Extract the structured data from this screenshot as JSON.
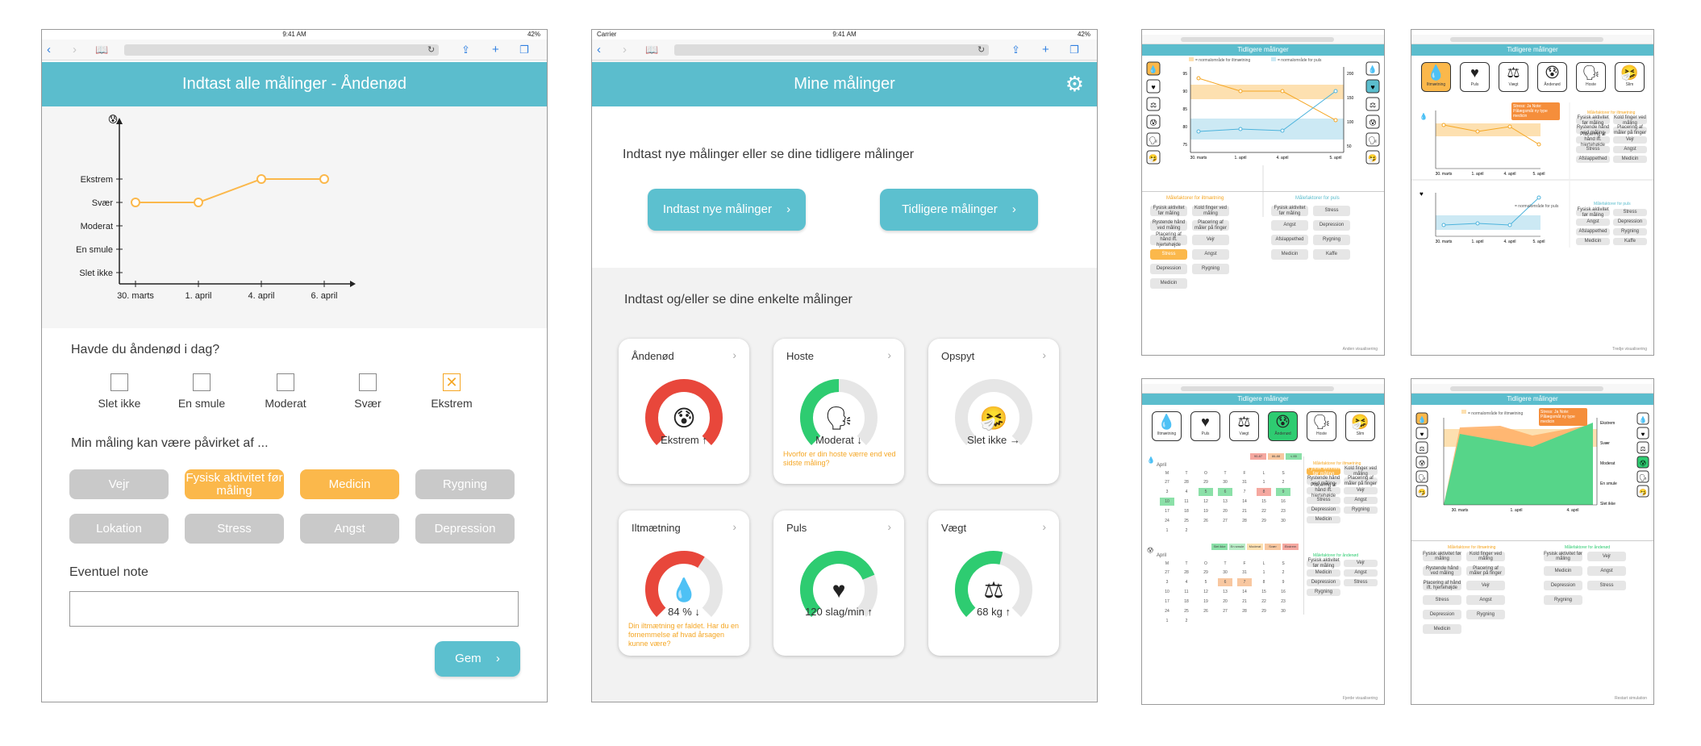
{
  "colors": {
    "teal": "#5bbdcd",
    "orange": "#fbb84b",
    "gray_pill": "#c9c9c9",
    "red_gauge": "#e8473b",
    "green_gauge": "#2ecc71",
    "warn": "#f5a623"
  },
  "s1": {
    "status_time": "9:41 AM",
    "status_battery": "42%",
    "title": "Indtast alle målinger - Åndenød",
    "chart_data": {
      "type": "line",
      "categories": [
        "30. marts",
        "1. april",
        "4. april",
        "6. april"
      ],
      "y_levels": [
        "Slet ikke",
        "En smule",
        "Moderat",
        "Svær",
        "Ekstrem"
      ],
      "values": [
        3,
        3,
        4,
        4
      ],
      "color": "#fbb84b"
    },
    "question": "Havde du åndenød i dag?",
    "options": [
      "Slet ikke",
      "En smule",
      "Moderat",
      "Svær",
      "Ekstrem"
    ],
    "selected_option": "Ekstrem",
    "affected_label": "Min måling kan være påvirket af ...",
    "factors": [
      {
        "label": "Vejr",
        "active": false
      },
      {
        "label": "Fysisk aktivitet før måling",
        "active": true
      },
      {
        "label": "Medicin",
        "active": true
      },
      {
        "label": "Rygning",
        "active": false
      },
      {
        "label": "Lokation",
        "active": false
      },
      {
        "label": "Stress",
        "active": false
      },
      {
        "label": "Angst",
        "active": false
      },
      {
        "label": "Depression",
        "active": false
      }
    ],
    "note_label": "Eventuel note",
    "note_value": "",
    "save_label": "Gem"
  },
  "s2": {
    "status_carrier": "Carrier",
    "status_time": "9:41 AM",
    "status_battery": "42%",
    "title": "Mine målinger",
    "intro": "Indtast nye målinger eller se dine tidligere målinger",
    "btn_new": "Indtast nye målinger",
    "btn_prev": "Tidligere målinger",
    "section": "Indtast og/eller se dine enkelte målinger",
    "cards": [
      {
        "title": "Åndenød",
        "value": "Ekstrem ↑",
        "level": 1.0,
        "color": "#e8473b",
        "icon": "😰",
        "warn": ""
      },
      {
        "title": "Hoste",
        "value": "Moderat ↓",
        "level": 0.5,
        "color": "#2ecc71",
        "icon": "🗣",
        "warn": "Hvorfor er din hoste værre end ved sidste måling?"
      },
      {
        "title": "Opspyt",
        "value": "Slet ikke →",
        "level": 0.0,
        "color": "#2ecc71",
        "icon": "🤧",
        "warn": ""
      },
      {
        "title": "Iltmætning",
        "value": "84 % ↓",
        "level": 0.62,
        "color": "#e8473b",
        "icon": "💧",
        "warn": "Din iltmætning er faldet. Har du en fornemmelse af hvad årsagen kunne være?"
      },
      {
        "title": "Puls",
        "value": "120 slag/min ↑",
        "level": 0.75,
        "color": "#2ecc71",
        "icon": "♥",
        "warn": ""
      },
      {
        "title": "Vægt",
        "value": "68 kg ↑",
        "level": 0.55,
        "color": "#2ecc71",
        "icon": "⚖",
        "warn": ""
      }
    ]
  },
  "s3": {
    "title": "Tidligere målinger",
    "legend1": "= normalområde for iltmætning",
    "legend2": "= normalområde for puls",
    "x_labels": [
      "30. marts",
      "1. april",
      "4. april",
      "5. april"
    ],
    "left_ticks": [
      "95",
      "90",
      "85",
      "80",
      "75"
    ],
    "right_ticks": [
      "200",
      "150",
      "100",
      "50"
    ],
    "left_head": "Målefaktorer for iltmætning",
    "right_head": "Målefaktorer for puls",
    "left_factors": [
      "Fysisk aktivitet før måling",
      "Kold finger ved måling",
      "Rystende hånd ved måling",
      "Placering af måler på finger",
      "Placering af hånd ift. hjertehøjde",
      "Vejr",
      "Stress",
      "Angst",
      "Depression",
      "Rygning",
      "Medicin"
    ],
    "right_factors": [
      "Fysisk aktivitet før måling",
      "Stress",
      "Angst",
      "Depression",
      "Afslappethed",
      "Rygning",
      "Medicin",
      "Kaffe"
    ],
    "footer": "Anden visualisering"
  },
  "s4": {
    "title": "Tidligere målinger",
    "tabs": [
      "Iltmætning",
      "Puls",
      "Vægt",
      "Åndenød",
      "Hoste",
      "Slim"
    ],
    "tooltip": "Stress: Ja Note: Pålægsmåt ny type medicin",
    "chart1_head": "Målefaktorer for iltmætning",
    "chart1_factors": [
      "Fysisk aktivitet før måling",
      "Kold finger ved måling",
      "Rystende hånd ved måling",
      "Placering af måler på finger",
      "Placering af hånd ift. hjertehøjde",
      "Vejr",
      "Stress",
      "Angst",
      "Afslappethed",
      "Medicin"
    ],
    "chart2_head": "Målefaktorer for puls",
    "chart2_legend": "= normalområde for puls",
    "chart2_factors": [
      "Fysisk aktivitet før måling",
      "Stress",
      "Angst",
      "Depression",
      "Afslappethed",
      "Rygning",
      "Medicin",
      "Kaffe"
    ],
    "x_labels": [
      "30. marts",
      "1. april",
      "4. april",
      "5. april"
    ],
    "footer": "Tredje visualisering"
  },
  "s5": {
    "title": "Tidligere målinger",
    "tabs": [
      "Iltmætning",
      "Puls",
      "Vægt",
      "Åndenød",
      "Hoste",
      "Slim"
    ],
    "month": "April",
    "weekdays": [
      "M",
      "T",
      "O",
      "T",
      "F",
      "L",
      "S"
    ],
    "days": [
      "27",
      "28",
      "29",
      "30",
      "31",
      "1",
      "2",
      "3",
      "4",
      "5",
      "6",
      "7",
      "8",
      "9",
      "10",
      "11",
      "12",
      "13",
      "14",
      "15",
      "16",
      "17",
      "18",
      "19",
      "20",
      "21",
      "22",
      "23",
      "24",
      "25",
      "26",
      "27",
      "28",
      "29",
      "30",
      "1",
      "2"
    ],
    "legend_a": [
      "90-87",
      "86-88",
      "≤ 85"
    ],
    "legend_b": [
      "Slet ikke",
      "En smule",
      "Moderat",
      "Svær",
      "Ekstrem"
    ],
    "head_a": "Målefaktorer for iltmætning",
    "head_b": "Målefaktorer for åndenød",
    "factors_a": [
      "Fysisk aktivitet før måling",
      "Kold finger ved måling",
      "Rystende hånd ved måling",
      "Placering af måler på finger",
      "Placering af hånd ift. hjertehøjde",
      "Vejr",
      "Stress",
      "Angst",
      "Depression",
      "Rygning",
      "Medicin"
    ],
    "factors_b": [
      "Fysisk aktivitet før måling",
      "Vejr",
      "Medicin",
      "Angst",
      "Depression",
      "Stress",
      "Rygning"
    ],
    "footer": "Fjerde visualisering"
  },
  "s6": {
    "title": "Tidligere målinger",
    "legend": "= normalområde for iltmætning",
    "tooltip": "Stress: Ja Note: Pålægsmåt ny type medicin",
    "y_right": [
      "Ekstrem",
      "Svær",
      "Moderat",
      "En smule",
      "Slet ikke"
    ],
    "x_labels": [
      "30. marts",
      "1. april",
      "4. april"
    ],
    "head_a": "Målefaktorer for iltmætning",
    "head_b": "Målefaktorer for åndenød",
    "factors_a": [
      "Fysisk aktivitet før måling",
      "Kold finger ved måling",
      "Rystende hånd ved måling",
      "Placering af måler på finger",
      "Placering af hånd ift. hjertehøjde",
      "Vejr",
      "Stress",
      "Angst",
      "Depression",
      "Rygning",
      "Medicin"
    ],
    "factors_b": [
      "Fysisk aktivitet før måling",
      "Vejr",
      "Medicin",
      "Angst",
      "Depression",
      "Stress",
      "Rygning"
    ],
    "footer": "Restart simulation"
  }
}
